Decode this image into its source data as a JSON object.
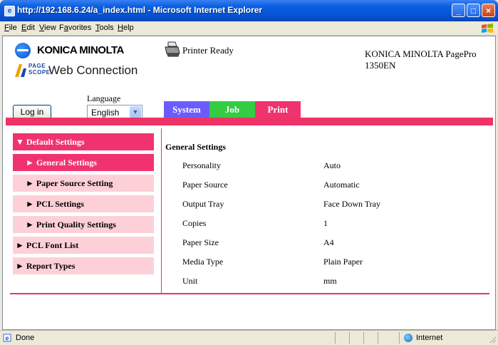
{
  "window": {
    "title": "http://192.168.6.24/a_index.html - Microsoft Internet Explorer",
    "controls": [
      "minimize",
      "maximize",
      "close"
    ]
  },
  "menubar": {
    "items": [
      {
        "label": "File",
        "accel": "F"
      },
      {
        "label": "Edit",
        "accel": "E"
      },
      {
        "label": "View",
        "accel": "V"
      },
      {
        "label": "Favorites",
        "accel": "a"
      },
      {
        "label": "Tools",
        "accel": "T"
      },
      {
        "label": "Help",
        "accel": "H"
      }
    ]
  },
  "header": {
    "brand": "KONICA MINOLTA",
    "pagescope_small": "PAGE\nSCOPE",
    "product": "Web Connection",
    "printer_status": "Printer Ready",
    "model": "KONICA MINOLTA PagePro 1350EN",
    "language_label": "Language",
    "login_label": "Log in",
    "language_value": "English"
  },
  "tabs": [
    {
      "label": "System",
      "color": "#6a5cff"
    },
    {
      "label": "Job",
      "color": "#33cc44"
    },
    {
      "label": "Print",
      "color": "#f0336e"
    }
  ],
  "sidebar": {
    "items": [
      {
        "label": "▼ Default Settings",
        "level": 0,
        "active": true
      },
      {
        "label": "► General Settings",
        "level": 1,
        "active": true
      },
      {
        "label": "► Paper Source Setting",
        "level": 1,
        "active": false
      },
      {
        "label": "► PCL Settings",
        "level": 1,
        "active": false
      },
      {
        "label": "► Print Quality Settings",
        "level": 1,
        "active": false
      },
      {
        "label": "► PCL Font List",
        "level": 0,
        "active": false
      },
      {
        "label": "► Report Types",
        "level": 0,
        "active": false
      }
    ]
  },
  "main": {
    "title": "General Settings",
    "rows": [
      {
        "label": "Personality",
        "value": "Auto"
      },
      {
        "label": "Paper Source",
        "value": "Automatic"
      },
      {
        "label": "Output Tray",
        "value": "Face Down Tray"
      },
      {
        "label": "Copies",
        "value": "1"
      },
      {
        "label": "Paper Size",
        "value": "A4"
      },
      {
        "label": "Media Type",
        "value": "Plain Paper"
      },
      {
        "label": "Unit",
        "value": "mm"
      }
    ]
  },
  "statusbar": {
    "text": "Done",
    "zone": "Internet"
  },
  "colors": {
    "accent": "#ee3366",
    "active_item": "#f0336e",
    "inactive_item": "#fdd0d8"
  }
}
